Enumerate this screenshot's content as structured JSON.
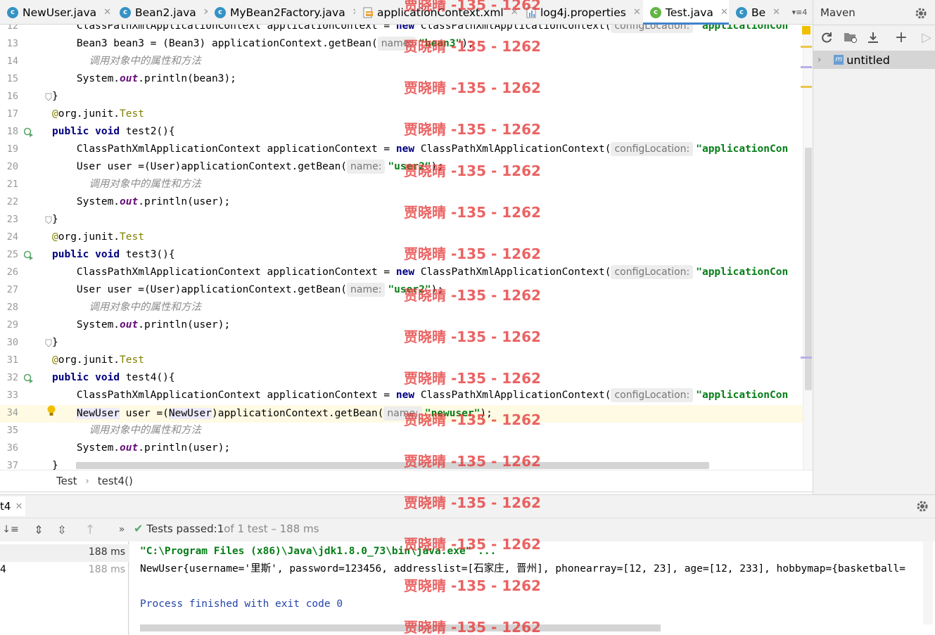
{
  "tabs": [
    {
      "label": "NewUser.java",
      "icon": "class-icon"
    },
    {
      "label": "Bean2.java",
      "icon": "class-icon"
    },
    {
      "label": "MyBean2Factory.java",
      "icon": "class-icon"
    },
    {
      "label": "applicationContext.xml",
      "icon": "xml-file-icon"
    },
    {
      "label": "log4j.properties",
      "icon": "properties-file-icon"
    },
    {
      "label": "Test.java",
      "icon": "test-class-icon"
    },
    {
      "label": "Be",
      "icon": "class-icon"
    }
  ],
  "tab_overflow_count": "4",
  "editor": {
    "line_numbers": [
      "12",
      "13",
      "14",
      "15",
      "16",
      "17",
      "18",
      "19",
      "20",
      "21",
      "22",
      "23",
      "24",
      "25",
      "26",
      "27",
      "28",
      "29",
      "30",
      "31",
      "32",
      "33",
      "34",
      "35",
      "36",
      "37"
    ],
    "tokens": {
      "cpxac": "ClassPathXmlApplicationContext",
      "appctx_decl": " applicationContext = ",
      "new_kw": "new",
      "cpxac_new": " ClassPathXmlApplicationContext(",
      "config_hint": "configLocation:",
      "config_str": "\"applicationCon",
      "name_hint": "name:",
      "public_kw": "public",
      "void_kw": "void",
      "ann_at": "@",
      "ann_pkg": "org.junit.",
      "ann_test": "Test",
      "comment": "调用对象中的属性和方法",
      "sysout_a": "System.",
      "sysout_out": "out",
      "brace_close": "}"
    },
    "line13": {
      "a": "Bean3 bean3 = (Bean3) applicationContext.getBean(",
      "str": "\"bean3\"",
      "b": ");"
    },
    "line15": {
      "b": ".println(bean3);"
    },
    "test2_sig": " test2(){",
    "test3_sig": " test3(){",
    "test4_sig": " test4(){",
    "user_get": {
      "a": "User user =(User)applicationContext.getBean(",
      "str": "\"user2\"",
      "b": ");"
    },
    "println_user": ".println(user);",
    "line34": {
      "t1": "NewUser",
      "mid": " user =(",
      "t2": "NewUser",
      "rest": ")applicationContext.getBean(",
      "str": "\"newuser\"",
      "b": ");"
    }
  },
  "breadcrumb": [
    "Test",
    "test4()"
  ],
  "maven": {
    "title": "Maven",
    "project": "untitled"
  },
  "run": {
    "tab_label": "t4",
    "status_prefix": "Tests passed: ",
    "passed": "1",
    "status_suffix": " of 1 test – 188 ms",
    "tree": [
      {
        "label": "",
        "time": "188 ms"
      },
      {
        "label": "4",
        "time": "188 ms"
      }
    ],
    "console": [
      "\"C:\\Program Files (x86)\\Java\\jdk1.8.0_73\\bin\\java.exe\" ...",
      "NewUser{username='里斯', password=123456, addresslist=[石家庄, 晋州], phonearray=[12, 23], age=[12, 233], hobbymap={basketball=",
      "",
      "Process finished with exit code 0"
    ]
  },
  "watermark": "贾晓晴 -135 - 1262",
  "colors": {
    "keyword": "#000080",
    "string": "#067d17",
    "field": "#660e7a",
    "annotation": "#808000",
    "accent": "#4083c9",
    "watermark": "#e63737"
  }
}
